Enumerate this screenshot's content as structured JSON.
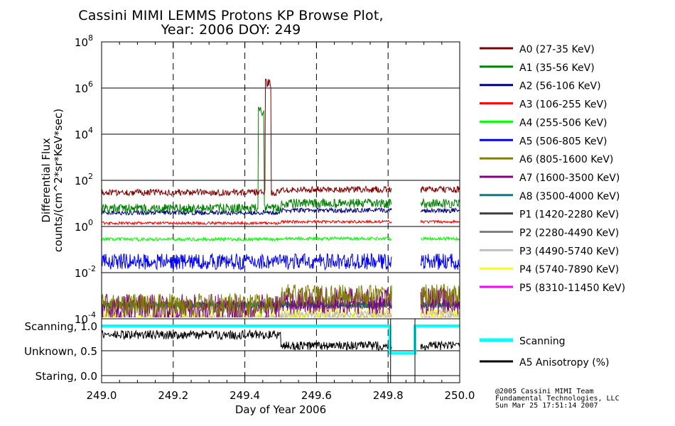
{
  "title": {
    "line1": "Cassini MIMI LEMMS Protons KP Browse Plot,",
    "line2": "Year: 2006 DOY: 249"
  },
  "chart_data": [
    {
      "id": "flux-panel",
      "type": "line",
      "ylabel": "Differential Flux",
      "ylabel2": "counts/(cm^2*sr*KeV*sec)",
      "y_scale": "log",
      "ylim": [
        0.0001,
        100000000
      ],
      "xlim": [
        249.0,
        250.0
      ],
      "y_ticks": [
        {
          "value": 100000000,
          "base": "10",
          "exp": "8"
        },
        {
          "value": 1000000,
          "base": "10",
          "exp": "6"
        },
        {
          "value": 10000,
          "base": "10",
          "exp": "4"
        },
        {
          "value": 100,
          "base": "10",
          "exp": "2"
        },
        {
          "value": 1,
          "base": "10",
          "exp": "0"
        },
        {
          "value": 0.01,
          "base": "10",
          "exp": "-2"
        },
        {
          "value": 0.0001,
          "base": "10",
          "exp": "-4"
        }
      ],
      "data_gap": [
        249.81,
        249.89
      ],
      "series": [
        {
          "name": "A0 (27-35 KeV)",
          "color": "#800000",
          "level": 30,
          "level_after": 40,
          "noise": 0.14,
          "spike_at": 249.465,
          "spike_value": 2500000
        },
        {
          "name": "A1 (35-56 KeV)",
          "color": "#008000",
          "level": 6,
          "level_after": 10,
          "noise": 0.2,
          "spike_at": 249.445,
          "spike_value": 150000
        },
        {
          "name": "A2 (56-106 KeV)",
          "color": "#000080",
          "level": 4,
          "level_after": 5,
          "noise": 0.1
        },
        {
          "name": "A3 (106-255 KeV)",
          "color": "#ff0000",
          "level": 1.4,
          "level_after": 1.6,
          "noise": 0.06
        },
        {
          "name": "A4 (255-506 KeV)",
          "color": "#00ff00",
          "level": 0.28,
          "level_after": 0.3,
          "noise": 0.07
        },
        {
          "name": "A5 (506-805 KeV)",
          "color": "#0000ff",
          "level": 0.03,
          "level_after": 0.03,
          "noise": 0.35
        },
        {
          "name": "A6 (805-1600 KeV)",
          "color": "#808000",
          "level": 0.0004,
          "level_after": 0.001,
          "noise": 0.5
        },
        {
          "name": "A7 (1600-3500 KeV)",
          "color": "#800080",
          "level": 0.0003,
          "level_after": 0.0006,
          "noise": 0.6
        },
        {
          "name": "A8 (3500-4000 KeV)",
          "color": "#008080",
          "level": 0.0004,
          "level_after": 0.0004,
          "noise": 0.1
        },
        {
          "name": "P1 (1420-2280 KeV)",
          "color": "#404040",
          "level": 0.0004,
          "level_after": 0.0004,
          "noise": 0.15
        },
        {
          "name": "P2 (2280-4490 KeV)",
          "color": "#808080",
          "level": 0.0004,
          "level_after": 0.0004,
          "noise": 0.2
        },
        {
          "name": "P3 (4490-5740 KeV)",
          "color": "#c0c0c0",
          "level": 0.0001,
          "level_after": 0.00015,
          "noise": 0.2
        },
        {
          "name": "P4 (5740-7890 KeV)",
          "color": "#ffff00",
          "level": 0.0001,
          "level_after": 0.00015,
          "noise": 0.3
        },
        {
          "name": "P5 (8310-11450 KeV)",
          "color": "#ff00ff",
          "level": 0.0001,
          "level_after": 0.0001,
          "noise": 0.1
        }
      ]
    },
    {
      "id": "mode-panel",
      "type": "line",
      "xlabel": "Day of Year 2006",
      "xlim": [
        249.0,
        250.0
      ],
      "x_ticks": [
        "249.0",
        "249.2",
        "249.4",
        "249.6",
        "249.8",
        "250.0"
      ],
      "ylim": [
        0.0,
        1.0
      ],
      "y_ticks": [
        {
          "value": 1.0,
          "label": "Scanning, 1.0"
        },
        {
          "value": 0.5,
          "label": "Unknown, 0.5"
        },
        {
          "value": 0.0,
          "label": "Staring, 0.0"
        }
      ],
      "series": [
        {
          "name": "Scanning",
          "color": "#00ffff",
          "points": [
            [
              249.0,
              1.0
            ],
            [
              249.805,
              1.0
            ],
            [
              249.805,
              0.45
            ],
            [
              249.875,
              0.45
            ],
            [
              249.875,
              1.0
            ],
            [
              250.0,
              1.0
            ]
          ]
        },
        {
          "name": "A5 Anisotropy (%)",
          "color": "#000000",
          "level": 0.82,
          "level_after": 0.6,
          "noise": 0.09
        }
      ]
    }
  ],
  "credit": {
    "line1": "@2005 Cassini MIMI Team",
    "line2": "Fundamental Technologies, LLC",
    "line3": "Sun Mar 25 17:51:14 2007"
  }
}
